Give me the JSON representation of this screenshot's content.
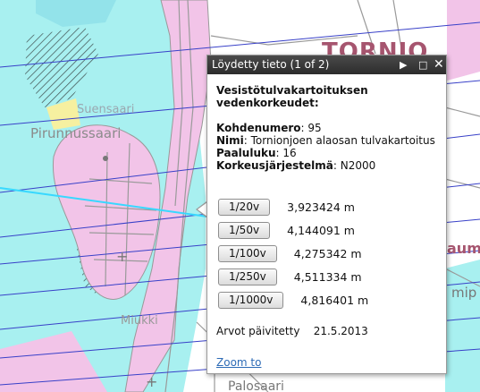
{
  "map": {
    "labels": {
      "tornio": "TORNIO",
      "suensaari": "Suensaari",
      "ruohonnussaari": "Pirunnussaari",
      "miukki": "Miukki",
      "palosaari": "Palosaari",
      "haaparanta_fragment": "aum",
      "katu_fragment": "mip"
    },
    "colors": {
      "water": "#a8f0f0",
      "deep_water": "#86dbe6",
      "land": "#ffffff",
      "urban": "#f2c4e8",
      "flood_line": "#38d8ff",
      "road": "#9a9a9a"
    }
  },
  "popup": {
    "title": "Löydetty tieto (1 of 2)",
    "icons": [
      "next-icon",
      "maximize-icon",
      "close-icon"
    ],
    "heading": "Vesistötulvakartoituksen vedenkorkeudet:",
    "fields": [
      {
        "label": "Kohdenumero",
        "value": "95"
      },
      {
        "label": "Nimi",
        "value": "Tornionjoen alaosan tulvakartoitus"
      },
      {
        "label": "Paaluluku",
        "value": "16"
      },
      {
        "label": "Korkeusjärjestelmä",
        "value": "N2000"
      }
    ],
    "return_periods": [
      {
        "button": "1/20v",
        "value": "3,923424 m"
      },
      {
        "button": "1/50v",
        "value": "4,144091 m"
      },
      {
        "button": "1/100v",
        "value": "4,275342 m"
      },
      {
        "button": "1/250v",
        "value": "4,511334 m"
      },
      {
        "button": "1/1000v",
        "value": "4,816401 m"
      }
    ],
    "updated_label": "Arvot päivitetty",
    "updated_date": "21.5.2013",
    "zoom_link": "Zoom to"
  }
}
